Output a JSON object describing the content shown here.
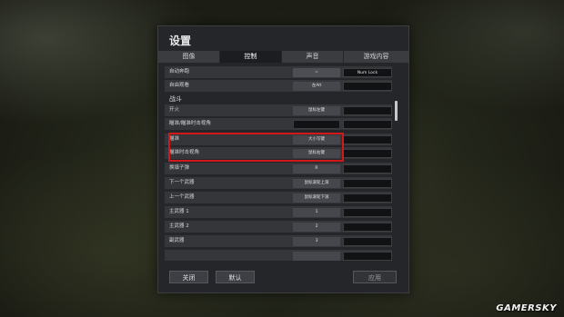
{
  "dialog": {
    "title": "设置",
    "tabs": [
      {
        "label": "图像",
        "active": false
      },
      {
        "label": "控制",
        "active": true
      },
      {
        "label": "声音",
        "active": false
      },
      {
        "label": "游戏内容",
        "active": false
      }
    ]
  },
  "bindings": {
    "rows_top": [
      {
        "label": "自动奔跑",
        "key1": "=",
        "key2": "Num Lock"
      },
      {
        "label": "自由观看",
        "key1": "左Alt",
        "key2": ""
      }
    ],
    "section_title": "战斗",
    "rows_combat": [
      {
        "label": "开火",
        "key1": "鼠标左键",
        "key2": ""
      },
      {
        "label": "瞄准/瞄准时击视角",
        "key1": "",
        "key2": ""
      },
      {
        "label": "瞄准",
        "key1": "大小写键",
        "key2": ""
      },
      {
        "label": "瞄准时击视角",
        "key1": "鼠标右键",
        "key2": ""
      },
      {
        "label": "换填子弹",
        "key1": "R",
        "key2": ""
      },
      {
        "label": "下一个武器",
        "key1": "鼠标滚轮上滚",
        "key2": ""
      },
      {
        "label": "上一个武器",
        "key1": "鼠标滚轮下滚",
        "key2": ""
      },
      {
        "label": "主武器 1",
        "key1": "1",
        "key2": ""
      },
      {
        "label": "主武器 2",
        "key1": "2",
        "key2": ""
      },
      {
        "label": "副武器",
        "key1": "3",
        "key2": ""
      }
    ]
  },
  "footer": {
    "close_label": "关闭",
    "default_label": "默认",
    "apply_label": "应用"
  },
  "watermark": "GAMERSKY",
  "colors": {
    "panel_bg": "#24262a",
    "active_tab": "#1c1d20",
    "highlight_box": "#d21818"
  }
}
